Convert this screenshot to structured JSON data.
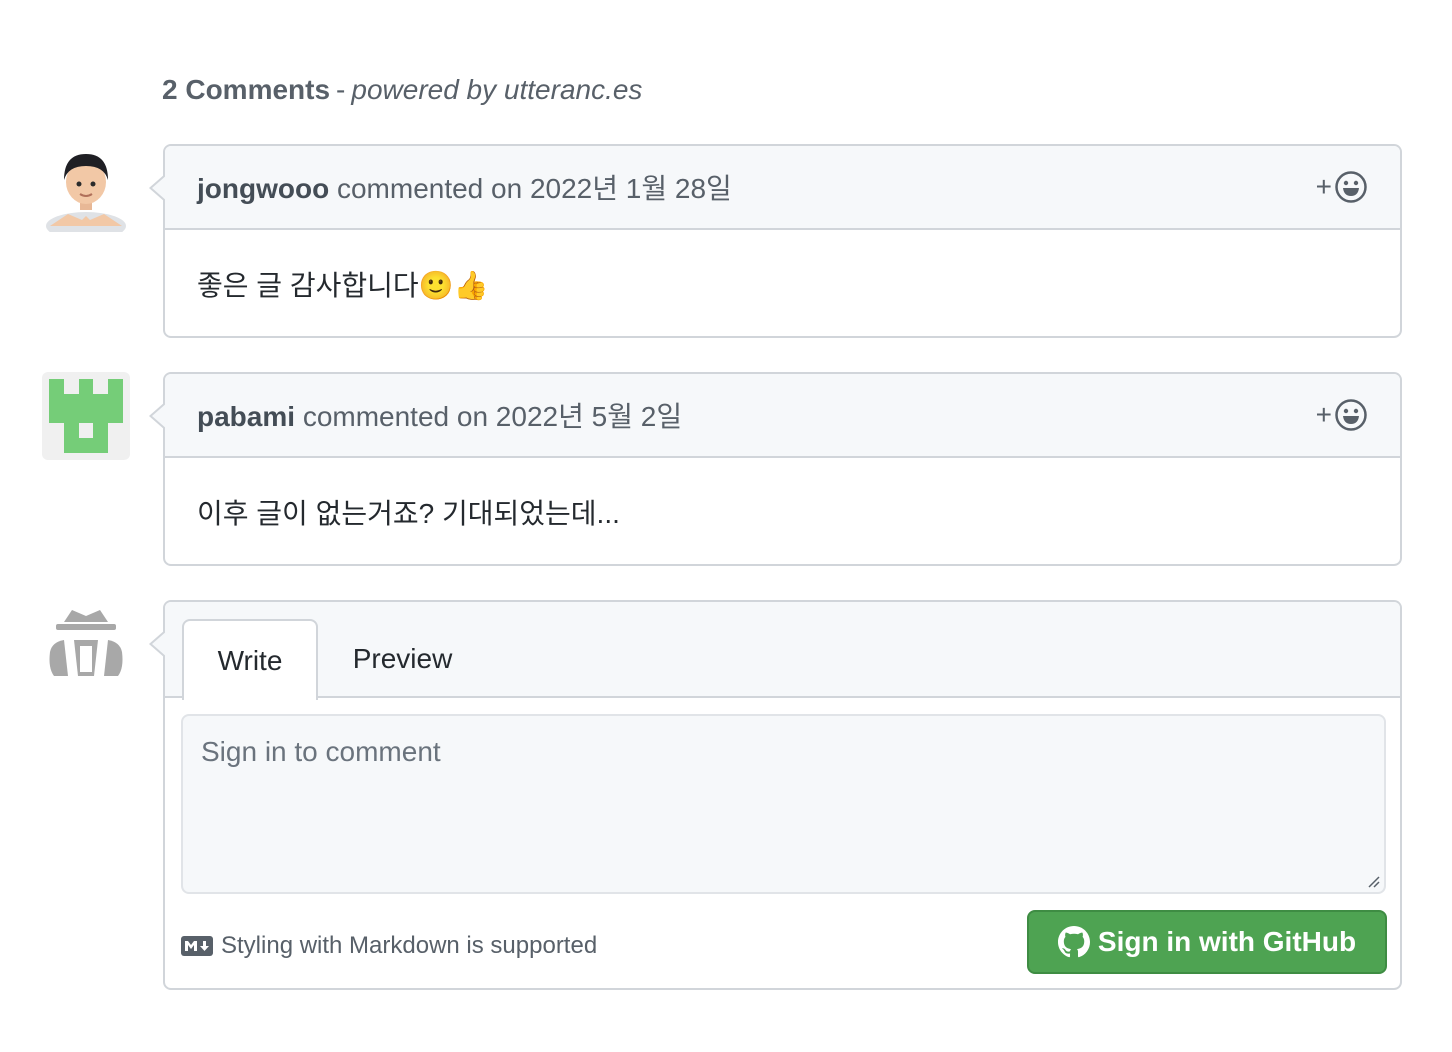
{
  "header": {
    "count_label": "2 Comments",
    "separator": "-",
    "powered_label": "powered by utteranc.es"
  },
  "comments": [
    {
      "author": "jongwooo",
      "meta": "commented on 2022년 1월 28일",
      "body": "좋은 글 감사합니다🙂👍",
      "reaction_plus": "+",
      "avatar": "memoji-avatar"
    },
    {
      "author": "pabami",
      "meta": "commented on 2022년 5월 2일",
      "body": "이후 글이 없는거죠? 기대되었는데...",
      "reaction_plus": "+",
      "avatar": "identicon-avatar"
    }
  ],
  "composer": {
    "tabs": [
      "Write",
      "Preview"
    ],
    "placeholder": "Sign in to comment",
    "markdown_note": "Styling with Markdown is supported",
    "signin_label": "Sign in with GitHub",
    "avatar": "anonymous-avatar"
  },
  "colors": {
    "border": "#d1d5da",
    "header_bg": "#f6f8fa",
    "button_green": "#4ea352",
    "identicon_green": "#75cd78"
  }
}
